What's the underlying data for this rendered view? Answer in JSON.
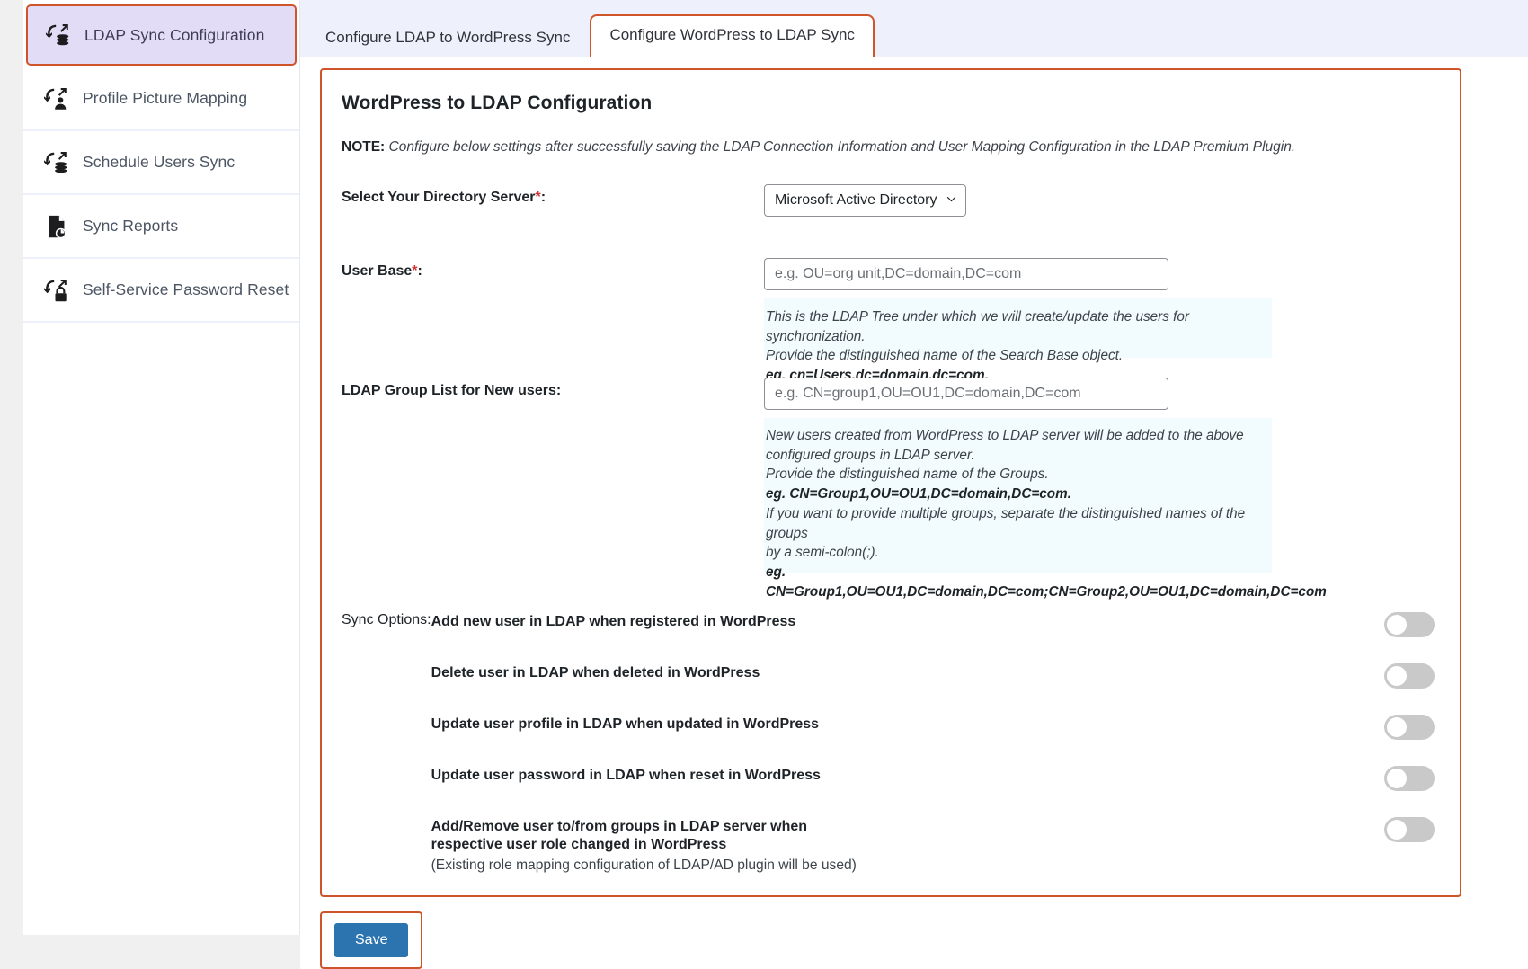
{
  "sidebar": {
    "items": [
      {
        "label": "LDAP Sync Configuration",
        "icon": "sync-database-icon",
        "active": true
      },
      {
        "label": "Profile Picture Mapping",
        "icon": "sync-person-icon",
        "active": false
      },
      {
        "label": "Schedule Users Sync",
        "icon": "sync-database-icon",
        "active": false
      },
      {
        "label": "Sync Reports",
        "icon": "report-document-icon",
        "active": false
      },
      {
        "label": "Self-Service Password Reset",
        "icon": "sync-lock-icon",
        "active": false
      }
    ]
  },
  "tabs": [
    {
      "label": "Configure LDAP to WordPress Sync",
      "active": false
    },
    {
      "label": "Configure WordPress to LDAP Sync",
      "active": true
    }
  ],
  "panel": {
    "title": "WordPress to LDAP Configuration",
    "note_prefix": "NOTE:",
    "note_text": "Configure below settings after successfully saving the LDAP Connection Information and User Mapping Configuration in the LDAP Premium Plugin.",
    "directory_server": {
      "label": "Select Your Directory Server",
      "required_marker": "*",
      "colon": ":",
      "selected": "Microsoft Active Directory",
      "options": [
        "Microsoft Active Directory"
      ],
      "caret_icon": "chevron-down-icon"
    },
    "user_base": {
      "label": "User Base",
      "required_marker": "*",
      "colon": ":",
      "value": "",
      "placeholder": "e.g. OU=org unit,DC=domain,DC=com",
      "help_line1": "This is the LDAP Tree under which we will create/update the users for synchronization.",
      "help_line2": "Provide the distinguished name of the Search Base object.",
      "help_line3_bold": "eg. cn=Users,dc=domain,dc=com."
    },
    "group_list": {
      "label": "LDAP Group List for New users:",
      "value": "",
      "placeholder": "e.g. CN=group1,OU=OU1,DC=domain,DC=com",
      "help_line1": "New users created from WordPress to LDAP server will be added to the above",
      "help_line2": "configured groups in LDAP server.",
      "help_line3": "Provide the distinguished name of the Groups.",
      "help_line4_bold": "eg. CN=Group1,OU=OU1,DC=domain,DC=com.",
      "help_line5": "If you want to provide multiple groups, separate the distinguished names of the groups",
      "help_line6": "by a semi-colon(;).",
      "help_line7_bold": "eg.",
      "help_line8_bold": "CN=Group1,OU=OU1,DC=domain,DC=com;CN=Group2,OU=OU1,DC=domain,DC=com"
    },
    "sync_options": {
      "label": "Sync Options:",
      "items": [
        {
          "text": "Add new user in LDAP when registered in WordPress",
          "note": "",
          "enabled": false
        },
        {
          "text": "Delete user in LDAP when deleted in WordPress",
          "note": "",
          "enabled": false
        },
        {
          "text": "Update user profile in LDAP when updated in WordPress",
          "note": "",
          "enabled": false
        },
        {
          "text": "Update user password in LDAP when reset in WordPress",
          "note": "",
          "enabled": false
        },
        {
          "text": "Add/Remove user to/from groups in LDAP server when respective user role changed in WordPress",
          "note": "(Existing role mapping configuration of LDAP/AD plugin will be used)",
          "enabled": false
        }
      ]
    }
  },
  "save": {
    "label": "Save"
  },
  "colors": {
    "accent_orange": "#d0542a",
    "active_sidebar_bg": "#e3dcf7",
    "tabstrip_bg": "#eef1fb",
    "help_bg": "#f2fbfd",
    "save_blue": "#2b74b0",
    "required_red": "#d63638",
    "toggle_off": "#c9c9c9"
  }
}
